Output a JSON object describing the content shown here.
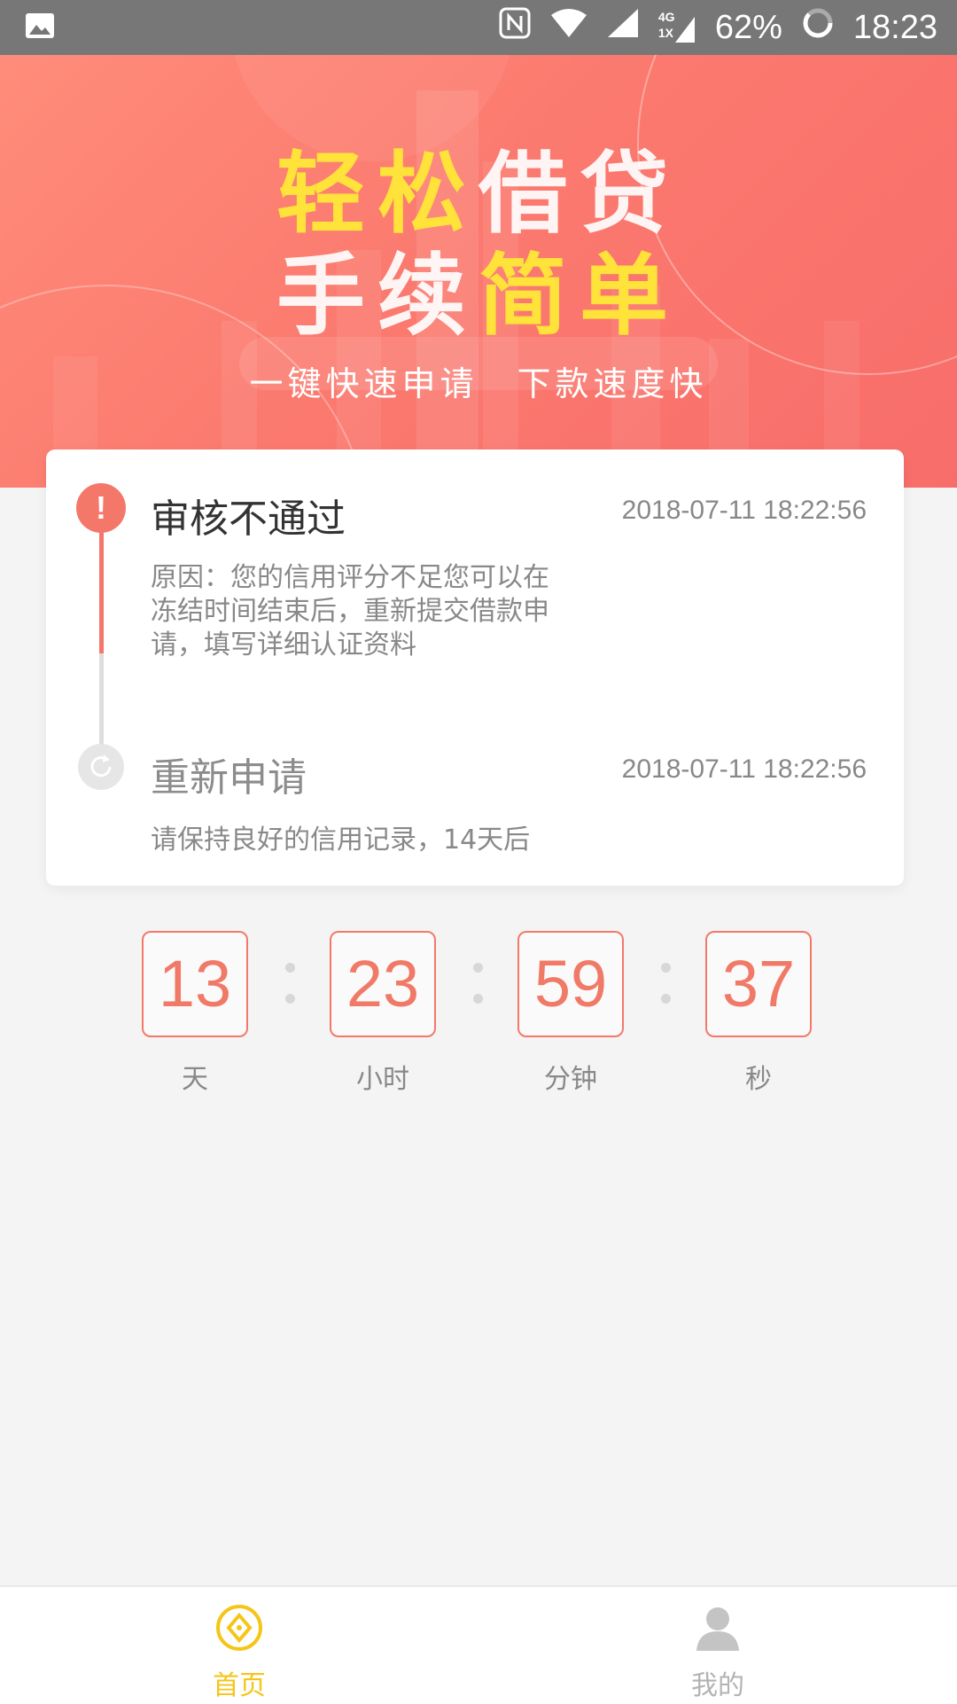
{
  "statusbar": {
    "battery": "62%",
    "time": "18:23",
    "network": "4G",
    "network2": "1X"
  },
  "banner": {
    "line1": [
      "轻松",
      "借贷"
    ],
    "line2": [
      "手续",
      "简单"
    ],
    "sub1": "一键快速申请",
    "sub2": "下款速度快"
  },
  "card": {
    "step1": {
      "title": "审核不通过",
      "time": "2018-07-11 18:22:56",
      "desc_line1": "原因：您的信用评分不足您可以在",
      "desc_line2": "冻结时间结束后，重新提交借款申",
      "desc_line3": "请，填写详细认证资料"
    },
    "step2": {
      "title": "重新申请",
      "time": "2018-07-11 18:22:56",
      "desc": "请保持良好的信用记录，14天后"
    }
  },
  "countdown": {
    "days": {
      "value": "13",
      "label": "天"
    },
    "hours": {
      "value": "23",
      "label": "小时"
    },
    "minutes": {
      "value": "59",
      "label": "分钟"
    },
    "seconds": {
      "value": "37",
      "label": "秒"
    }
  },
  "nav": {
    "home": "首页",
    "mine": "我的"
  },
  "colors": {
    "accent": "#f4786a",
    "yellow": "#f5c518"
  }
}
